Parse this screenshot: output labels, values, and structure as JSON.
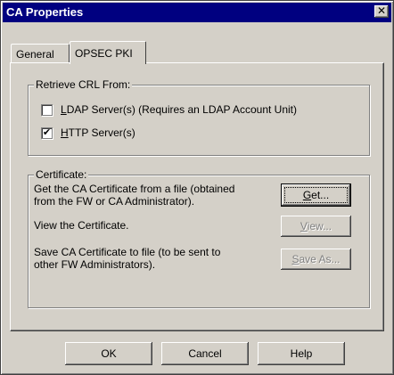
{
  "window": {
    "title": "CA Properties",
    "close_glyph": "✕"
  },
  "tabs": [
    {
      "label": "General",
      "selected": false
    },
    {
      "label": "OPSEC PKI",
      "selected": true
    }
  ],
  "retrieve_crl": {
    "legend": "Retrieve CRL From:",
    "ldap": {
      "label_ul": "L",
      "label_rest": "DAP Server(s) (Requires an LDAP Account Unit)",
      "checked": false,
      "check_glyph": ""
    },
    "http": {
      "label_ul": "H",
      "label_rest": "TTP Server(s)",
      "checked": true,
      "check_glyph": "✔"
    }
  },
  "certificate": {
    "legend": "Certificate:",
    "get_desc_line1": "Get the CA Certificate from a file (obtained",
    "get_desc_line2": "from the FW or CA Administrator).",
    "get_btn_ul": "G",
    "get_btn_rest": "et...",
    "view_desc": "View the Certificate.",
    "view_btn_ul": "V",
    "view_btn_rest": "iew...",
    "save_desc_line1": "Save CA Certificate to file (to be sent to",
    "save_desc_line2": "other FW Administrators).",
    "save_btn_ul": "S",
    "save_btn_rest": "ave As..."
  },
  "footer": {
    "ok": "OK",
    "cancel": "Cancel",
    "help": "Help"
  }
}
